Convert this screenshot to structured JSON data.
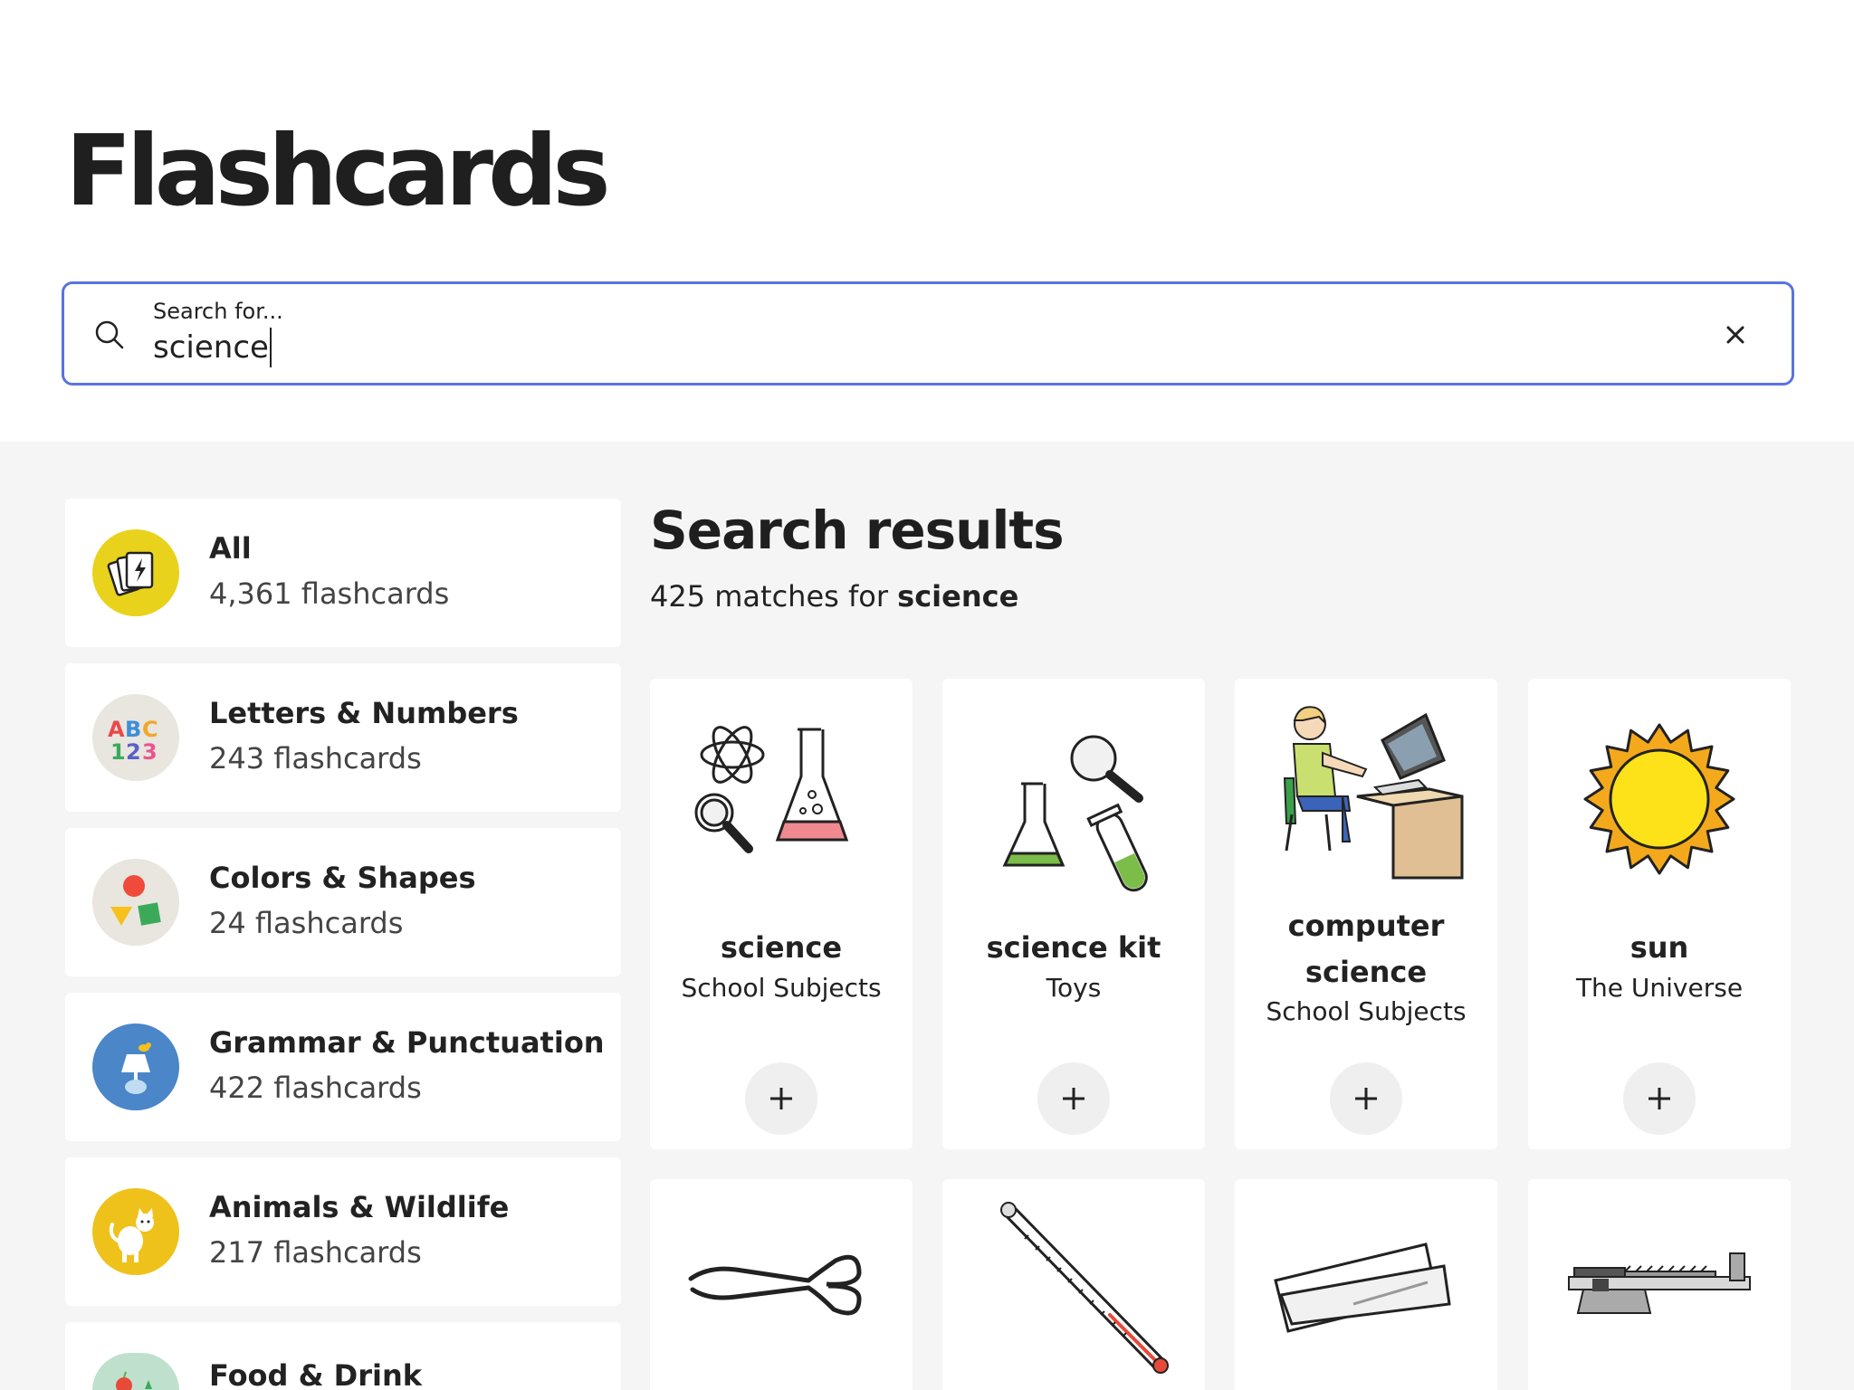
{
  "page": {
    "title": "Flashcards"
  },
  "search": {
    "label": "Search for...",
    "value": "science"
  },
  "categories": [
    {
      "name": "All",
      "count": "4,361 flashcards",
      "icon": "flashcards-icon",
      "color": "#e8d21c"
    },
    {
      "name": "Letters & Numbers",
      "count": "243 flashcards",
      "icon": "abc-123-icon",
      "color": "#e9e5df"
    },
    {
      "name": "Colors & Shapes",
      "count": "24 flashcards",
      "icon": "shapes-icon",
      "color": "#e9e5df"
    },
    {
      "name": "Grammar & Punctuation",
      "count": "422 flashcards",
      "icon": "lamp-bird-icon",
      "color": "#4a86c8"
    },
    {
      "name": "Animals & Wildlife",
      "count": "217 flashcards",
      "icon": "cat-icon",
      "color": "#eec21b"
    },
    {
      "name": "Food & Drink",
      "count": "",
      "icon": "food-icon",
      "color": "#bfe0cd"
    }
  ],
  "results": {
    "title": "Search results",
    "count_text": "425 matches for",
    "query": "science",
    "cards": [
      {
        "title": "science",
        "subtitle": "School Subjects"
      },
      {
        "title": "science kit",
        "subtitle": "Toys"
      },
      {
        "title_line1": "computer",
        "title_line2": "science",
        "subtitle": "School Subjects"
      },
      {
        "title": "sun",
        "subtitle": "The Universe"
      },
      {
        "image": "tongs"
      },
      {
        "image": "thermometer"
      },
      {
        "image": "microscope-slides"
      },
      {
        "image": "balance-scale"
      }
    ]
  }
}
